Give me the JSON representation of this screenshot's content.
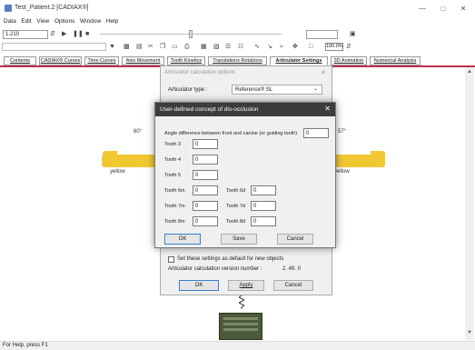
{
  "window": {
    "title": "Test_Patient.2 [CADIAX®]",
    "minimize": "—",
    "maximize": "□",
    "close": "✕"
  },
  "menu": [
    "Data",
    "Edit",
    "View",
    "Options",
    "Window",
    "Help"
  ],
  "toolbar": {
    "time_value": "1.210",
    "zoom_value": "100.0%"
  },
  "tabs": [
    "Contents",
    "CADIAX® Curves",
    "Time Curves",
    "Axis Movement",
    "Tooth Kinetics",
    "Translations Rotations",
    "Articulator Settings",
    "3D Animation",
    "Numerical Analysis"
  ],
  "workspace": {
    "left_angle": "60°",
    "right_angle": "57°",
    "left_color": "yellow",
    "right_color": "yellow"
  },
  "back_dialog": {
    "title": "Articulator calculation options",
    "articulator_type_label": "Articulator type :",
    "articulator_type_value": "Reference® SL",
    "save_default_label": "Set these settings as default for new objects",
    "version_label": "Articulator calculation version number :",
    "version_value": "2. 49. 0",
    "ok": "OK",
    "apply": "Apply",
    "cancel": "Cancel"
  },
  "dialog": {
    "title": "User-defined concept of dis-occlusion",
    "angle_label": "Angle difference between front and canine (or guiding tooth)",
    "angle_value": "0",
    "teeth": [
      {
        "label": "Tooth 3",
        "value": "0"
      },
      {
        "label": "Tooth 4",
        "value": "0"
      },
      {
        "label": "Tooth 5",
        "value": "0"
      },
      {
        "label": "Tooth 6m",
        "value": "0"
      },
      {
        "label": "Tooth 7m",
        "value": "0"
      },
      {
        "label": "Tooth 8m",
        "value": "0"
      },
      {
        "label": "Tooth 6d",
        "value": "0"
      },
      {
        "label": "Tooth 7d",
        "value": "0"
      },
      {
        "label": "Tooth 8d",
        "value": "0"
      }
    ],
    "ok": "OK",
    "save": "Save",
    "cancel": "Cancel"
  },
  "status": "For Help, press F1",
  "colors": {
    "articulator": "#f1c832",
    "dialog_title_bar": "#3c3c3c",
    "tab_accent": "#c03050"
  }
}
